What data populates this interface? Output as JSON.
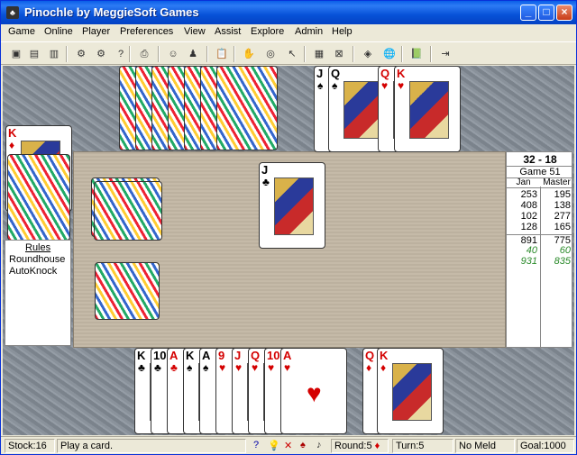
{
  "window": {
    "title": "Pinochle by MeggieSoft Games",
    "icon": "app-icon"
  },
  "menu": [
    "Game",
    "Online",
    "Player",
    "Preferences",
    "View",
    "Assist",
    "Explore",
    "Admin",
    "Help"
  ],
  "toolbar_icons": [
    "new-game-icon",
    "open-icon",
    "save-icon",
    "computer-icon",
    "network-icon",
    "help-query-icon",
    "print-icon",
    "player-icon",
    "wizard-icon",
    "clipboard-icon",
    "hand-icon",
    "meld-icon",
    "pointer-icon",
    "cards-icon",
    "deal-icon",
    "bid-icon",
    "globe-icon",
    "book-icon",
    "exit-icon"
  ],
  "north": {
    "backs": 7,
    "faceup": [
      {
        "rank": "J",
        "suit": "♠",
        "color": "#000000"
      },
      {
        "rank": "Q",
        "suit": "♠",
        "color": "#000000"
      },
      {
        "rank": "Q",
        "suit": "♥",
        "color": "#d40000"
      },
      {
        "rank": "K",
        "suit": "♥",
        "color": "#d40000"
      }
    ]
  },
  "west": {
    "faceup": [
      {
        "rank": "K",
        "suit": "♦",
        "color": "#d40000"
      }
    ],
    "backs": 1
  },
  "trick": [
    {
      "rank": "J",
      "suit": "♣",
      "color": "#000000"
    }
  ],
  "deck": {
    "label": "stock"
  },
  "rules": {
    "title": "Rules",
    "lines": [
      "Roundhouse",
      "AutoKnock"
    ]
  },
  "score": {
    "header": "32 - 18",
    "game": "Game  51",
    "cols": [
      "Jan",
      "Master"
    ],
    "rows": [
      [
        "253",
        "195"
      ],
      [
        "408",
        "138"
      ],
      [
        "102",
        "277"
      ],
      [
        "128",
        "165"
      ],
      [
        "891",
        "775"
      ],
      [
        "40",
        "60"
      ],
      [
        "931",
        "835"
      ]
    ]
  },
  "south": {
    "hand": [
      {
        "rank": "K",
        "suit": "♣",
        "color": "#000000"
      },
      {
        "rank": "10",
        "suit": "♣",
        "color": "#000000"
      },
      {
        "rank": "A",
        "suit": "♣",
        "color": "#d40000"
      },
      {
        "rank": "K",
        "suit": "♠",
        "color": "#000000"
      },
      {
        "rank": "A",
        "suit": "♠",
        "color": "#000000"
      },
      {
        "rank": "9",
        "suit": "♥",
        "color": "#d40000"
      },
      {
        "rank": "J",
        "suit": "♥",
        "color": "#d40000"
      },
      {
        "rank": "Q",
        "suit": "♥",
        "color": "#d40000"
      },
      {
        "rank": "10",
        "suit": "♥",
        "color": "#d40000"
      },
      {
        "rank": "A",
        "suit": "♥",
        "color": "#d40000"
      }
    ],
    "meld": [
      {
        "rank": "Q",
        "suit": "♦",
        "color": "#d40000"
      },
      {
        "rank": "K",
        "suit": "♦",
        "color": "#d40000"
      }
    ]
  },
  "status": {
    "stock": "Stock:16",
    "message": "Play a card.",
    "round": "Round:5",
    "turn": "Turn:5",
    "meld": "No Meld",
    "goal": "Goal:1000"
  }
}
